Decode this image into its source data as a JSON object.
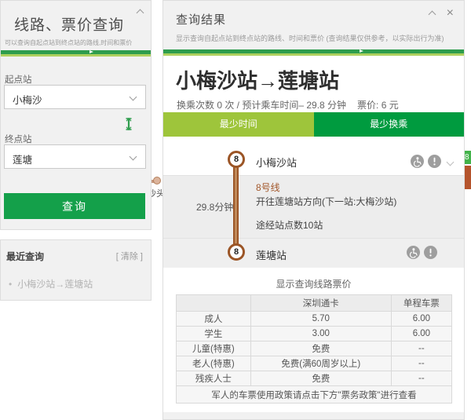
{
  "colors": {
    "accent_green": "#14a04a",
    "stripe_dark_green": "#2e9d4d",
    "stripe_light_green": "#aed05e",
    "tab_active_green": "#9ec53b",
    "tab_inactive_green": "#009b3f",
    "line8_brown": "#9b5526"
  },
  "left_panel": {
    "title": "线路、票价查询",
    "subtitle": "可以查询自起点站到终点站的路线,时间和票价",
    "origin_label": "起点站",
    "origin_value": "小梅沙",
    "dest_label": "终点站",
    "dest_value": "莲塘",
    "query_button": "查询"
  },
  "recent_panel": {
    "title": "最近查询",
    "clear_link": "[ 清除 ]",
    "items": [
      "小梅沙站→莲塘站"
    ]
  },
  "map_fragment": {
    "station_label": "沙头",
    "line_badge_fragment": "8"
  },
  "result_panel": {
    "title": "查询结果",
    "subtitle": "显示查询自起点站到终点站的路线、时间和票价 (查询结果仅供参考，以实际出行为准)",
    "route_title": "小梅沙站→莲塘站",
    "meta": "换乘次数 0 次 / 预计乘车时间– 29.8 分钟",
    "meta_fare": "票价: 6 元",
    "tabs": [
      {
        "label": "最少时间",
        "active": true
      },
      {
        "label": "最少换乘",
        "active": false
      }
    ],
    "route": {
      "line_badge": "8",
      "from_station": "小梅沙站",
      "duration": "29.8分钟",
      "line_name": "8号线",
      "direction": "开往莲塘站方向(下一站:大梅沙站)",
      "stops": "途经站点数10站",
      "to_station": "莲塘站"
    },
    "fare": {
      "section_title": "显示查询线路票价",
      "headers": [
        "",
        "深圳通卡",
        "单程车票"
      ],
      "rows": [
        [
          "成人",
          "5.70",
          "6.00"
        ],
        [
          "学生",
          "3.00",
          "6.00"
        ],
        [
          "儿童(特惠)",
          "免费",
          "--"
        ],
        [
          "老人(特惠)",
          "免费(满60周岁以上)",
          "--"
        ],
        [
          "残疾人士",
          "免费",
          "--"
        ]
      ],
      "footer": "军人的车票使用政策请点击下方\"票务政策\"进行查看"
    }
  }
}
